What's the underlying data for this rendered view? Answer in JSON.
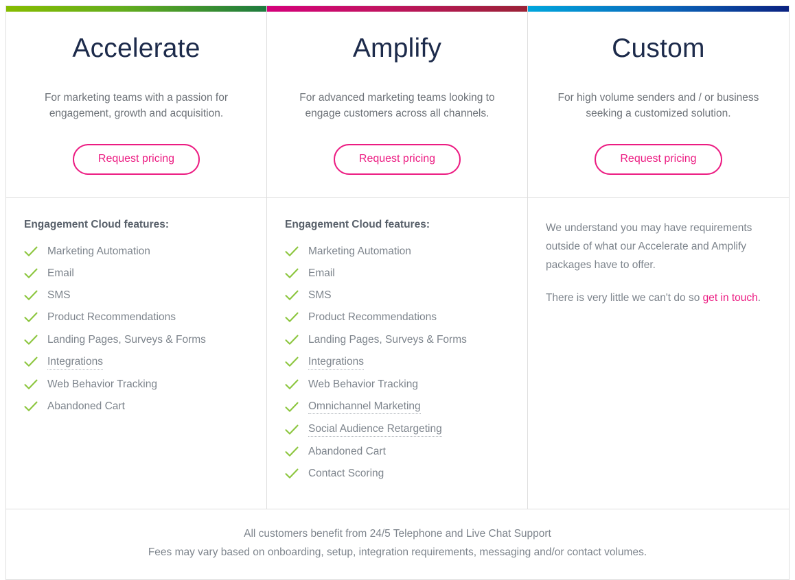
{
  "plans": [
    {
      "id": "accelerate",
      "title": "Accelerate",
      "description": "For marketing teams with a passion for engagement, growth and acquisition.",
      "cta_label": "Request pricing",
      "accent_start": "#86bc00",
      "accent_end": "#1d7a3e",
      "features_title": "Engagement Cloud features:",
      "features": [
        {
          "label": "Marketing Automation",
          "tooltip": false
        },
        {
          "label": "Email",
          "tooltip": false
        },
        {
          "label": "SMS",
          "tooltip": false
        },
        {
          "label": "Product Recommendations",
          "tooltip": false
        },
        {
          "label": "Landing Pages, Surveys & Forms",
          "tooltip": false
        },
        {
          "label": "Integrations",
          "tooltip": true
        },
        {
          "label": "Web Behavior Tracking",
          "tooltip": false
        },
        {
          "label": "Abandoned Cart",
          "tooltip": false
        }
      ]
    },
    {
      "id": "amplify",
      "title": "Amplify",
      "description": "For advanced marketing teams looking to engage customers across all channels.",
      "cta_label": "Request pricing",
      "accent_start": "#d4007a",
      "accent_end": "#9a2236",
      "features_title": "Engagement Cloud features:",
      "features": [
        {
          "label": "Marketing Automation",
          "tooltip": false
        },
        {
          "label": "Email",
          "tooltip": false
        },
        {
          "label": "SMS",
          "tooltip": false
        },
        {
          "label": "Product Recommendations",
          "tooltip": false
        },
        {
          "label": "Landing Pages, Surveys & Forms",
          "tooltip": false
        },
        {
          "label": "Integrations",
          "tooltip": true
        },
        {
          "label": "Web Behavior Tracking",
          "tooltip": false
        },
        {
          "label": "Omnichannel Marketing",
          "tooltip": true
        },
        {
          "label": "Social Audience Retargeting",
          "tooltip": true
        },
        {
          "label": "Abandoned Cart",
          "tooltip": false
        },
        {
          "label": "Contact Scoring",
          "tooltip": false
        }
      ]
    },
    {
      "id": "custom",
      "title": "Custom",
      "description": "For high volume senders and / or business seeking a customized solution.",
      "cta_label": "Request pricing",
      "accent_start": "#00a6dd",
      "accent_end": "#0a2180",
      "body_paragraph_1": "We understand you may have requirements outside of what our Accelerate and Amplify packages have to offer.",
      "body_paragraph_2_before": "There is very little we can't do so ",
      "body_link": "get in touch",
      "body_paragraph_2_after": "."
    }
  ],
  "footer": {
    "line_1": "All customers benefit from 24/5 Telephone and Live Chat Support",
    "line_2": "Fees may vary based on onboarding, setup, integration requirements, messaging and/or contact volumes."
  },
  "icons": {
    "check": "check-icon"
  },
  "colors": {
    "accent_pink": "#ec1c82",
    "check_green": "#8cc63e",
    "title_navy": "#1d2b4b",
    "body_gray": "#7d848c",
    "border_gray": "#dedede"
  }
}
